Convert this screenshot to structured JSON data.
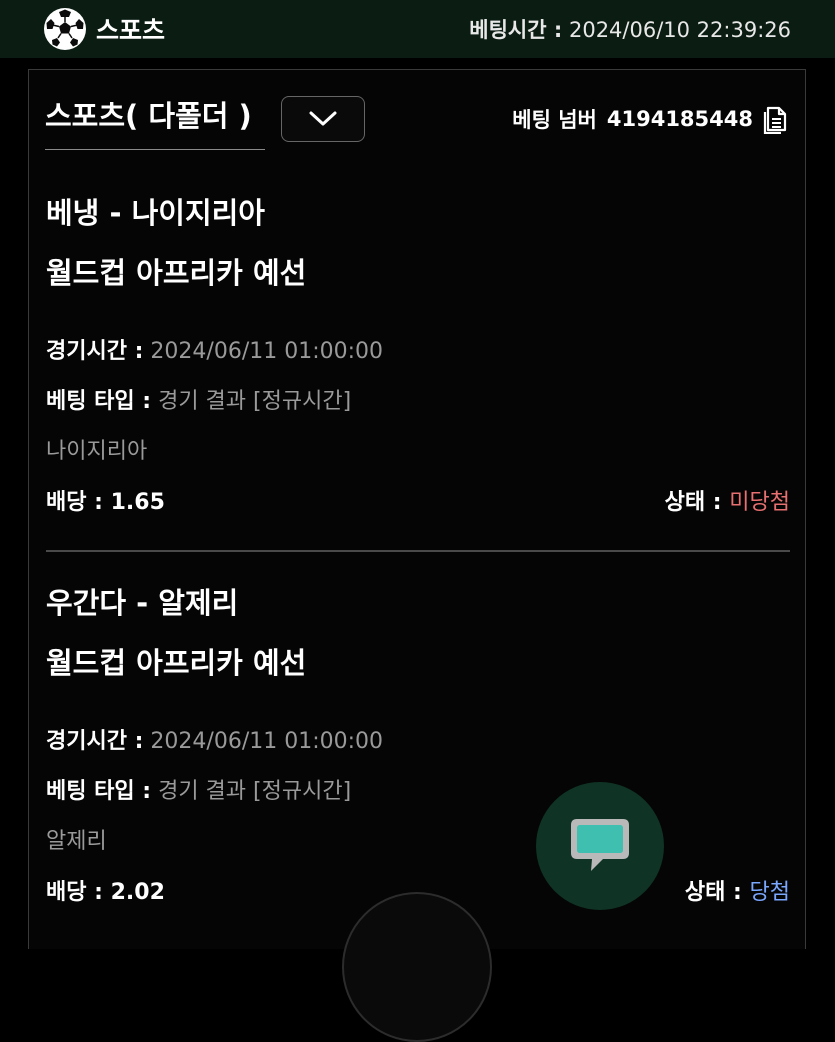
{
  "header": {
    "brand_label": "스포츠",
    "bet_time_label": "베팅시간 :",
    "bet_time_value": "2024/06/10 22:39:26"
  },
  "panel": {
    "title": "스포츠( 다폴더 )",
    "bet_number_label": "베팅 넘버",
    "bet_number_value": "4194185448"
  },
  "bets": [
    {
      "match": "베냉 - 나이지리아",
      "league": "월드컵 아프리카 예선",
      "game_time_label": "경기시간 :",
      "game_time_value": "2024/06/11 01:00:00",
      "bet_type_label": "베팅 타입 :",
      "bet_type_value": "경기 결과 [정규시간]",
      "pick": "나이지리아",
      "odds_label": "배당 :",
      "odds_value": "1.65",
      "status_label": "상태 :",
      "status_value": "미당첨"
    },
    {
      "match": "우간다 - 알제리",
      "league": "월드컵 아프리카 예선",
      "game_time_label": "경기시간 :",
      "game_time_value": "2024/06/11 01:00:00",
      "bet_type_label": "베팅 타입 :",
      "bet_type_value": "경기 결과 [정규시간]",
      "pick": "알제리",
      "odds_label": "배당 :",
      "odds_value": "2.02",
      "status_label": "상태 :",
      "status_value": "당첨"
    }
  ],
  "colors": {
    "lose": "#e87070",
    "win": "#7aa7ff",
    "header_bg": "#0b1d13",
    "fab_bg": "#0f3324",
    "fab_icon": "#3fbfb0"
  },
  "icons": {
    "brand": "soccer-ball-icon",
    "dropdown": "chevron-down-icon",
    "copy": "copy-document-icon",
    "chat": "chat-bubble-icon"
  }
}
